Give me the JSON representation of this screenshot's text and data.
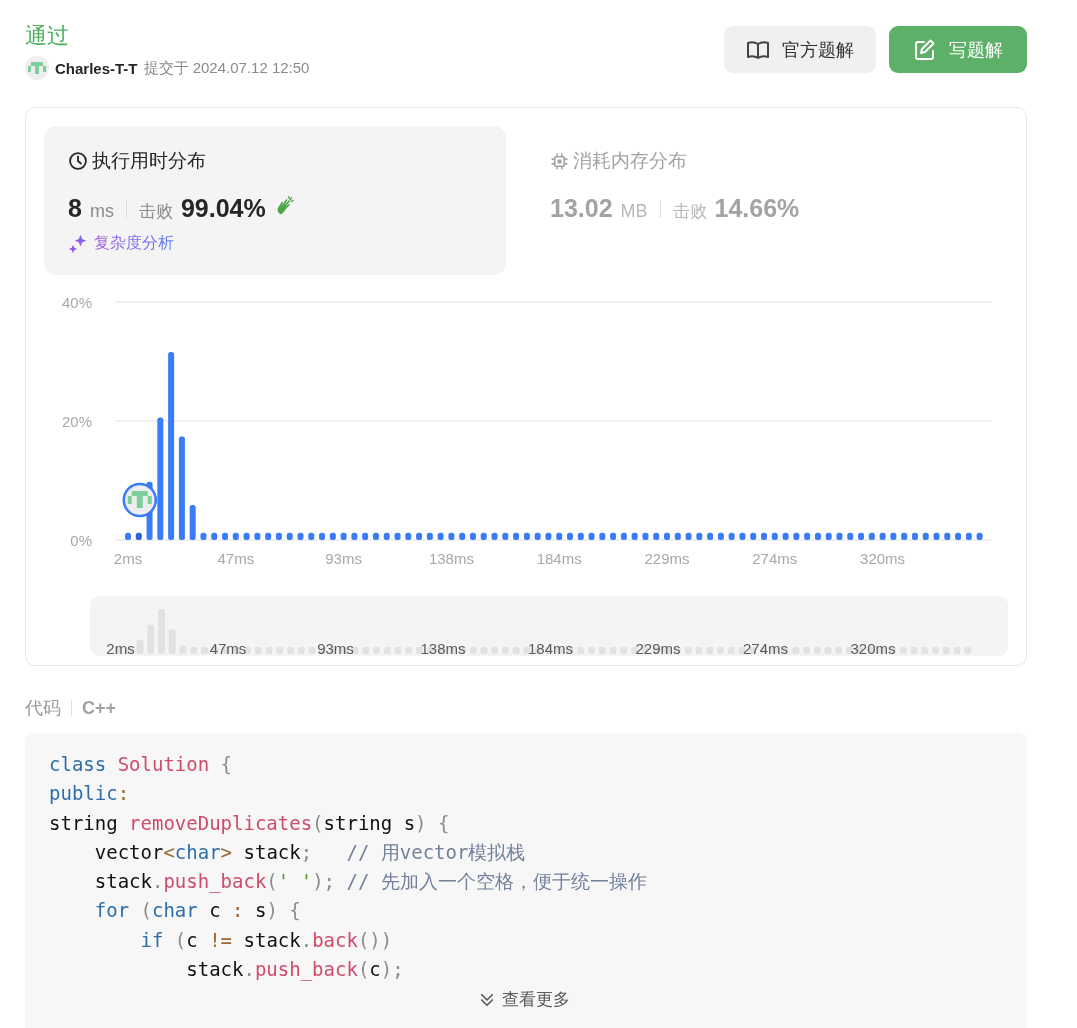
{
  "status": "通过",
  "submission": {
    "user": "Charles-T-T",
    "submitted_label": "提交于",
    "time": "2024.07.12 12:50"
  },
  "buttons": [
    {
      "label": "官方题解",
      "kind": "solutions"
    },
    {
      "label": "写题解",
      "kind": "write"
    }
  ],
  "stats": [
    {
      "kind": "runtime",
      "title": "执行用时分布",
      "value": "8",
      "unit": "ms",
      "beat_label": "击败",
      "beat": "99.04%",
      "selected": true,
      "link": "复杂度分析"
    },
    {
      "kind": "memory",
      "title": "消耗内存分布",
      "value": "13.02",
      "unit": "MB",
      "beat_label": "击败",
      "beat": "14.66%",
      "selected": false
    }
  ],
  "chart_data": {
    "type": "bar",
    "ylim": [
      0,
      40
    ],
    "yticks": [
      {
        "value": 0,
        "label": "0%"
      },
      {
        "value": 20,
        "label": "20%"
      },
      {
        "value": 40,
        "label": "40%"
      }
    ],
    "categories": [
      "2ms",
      null,
      null,
      null,
      null,
      null,
      null,
      null,
      null,
      null,
      "47ms",
      null,
      null,
      null,
      null,
      null,
      null,
      null,
      null,
      null,
      "93ms",
      null,
      null,
      null,
      null,
      null,
      null,
      null,
      null,
      null,
      "138ms",
      null,
      null,
      null,
      null,
      null,
      null,
      null,
      null,
      null,
      "184ms",
      null,
      null,
      null,
      null,
      null,
      null,
      null,
      null,
      null,
      "229ms",
      null,
      null,
      null,
      null,
      null,
      null,
      null,
      null,
      null,
      "274ms",
      null,
      null,
      null,
      null,
      null,
      null,
      null,
      null,
      null,
      "320ms",
      null,
      null,
      null,
      null,
      null,
      null,
      null,
      null,
      null
    ],
    "values": [
      1.2,
      1.2,
      9.8,
      20.6,
      31.6,
      17.4,
      5.9,
      1.2,
      1.2,
      1.2,
      1.2,
      1.2,
      1.2,
      1.2,
      1.2,
      1.2,
      1.2,
      1.2,
      1.2,
      1.2,
      1.2,
      1.2,
      1.2,
      1.2,
      1.2,
      1.2,
      1.2,
      1.2,
      1.2,
      1.2,
      1.2,
      1.2,
      1.2,
      1.2,
      1.2,
      1.2,
      1.2,
      1.2,
      1.2,
      1.2,
      1.2,
      1.2,
      1.2,
      1.2,
      1.2,
      1.2,
      1.2,
      1.2,
      1.2,
      1.2,
      1.2,
      1.2,
      1.2,
      1.2,
      1.2,
      1.2,
      1.2,
      1.2,
      1.2,
      1.2,
      1.2,
      1.2,
      1.2,
      1.2,
      1.2,
      1.2,
      1.2,
      1.2,
      1.2,
      1.2,
      1.2,
      1.2,
      1.2,
      1.2,
      1.2,
      1.2,
      1.2,
      1.2,
      1.2,
      1.2
    ]
  },
  "overview": {
    "tick_labels": [
      "2ms",
      "47ms",
      "93ms",
      "138ms",
      "184ms",
      "229ms",
      "274ms",
      "320ms"
    ]
  },
  "code": {
    "label": "代码",
    "language": "C++",
    "more": "查看更多",
    "lines": [
      [
        {
          "t": "class ",
          "kind": "keyword"
        },
        {
          "t": "Solution",
          "kind": "name"
        },
        {
          "t": " {",
          "kind": "punct"
        }
      ],
      [
        {
          "t": "public",
          "kind": "keyword"
        },
        {
          "t": ":",
          "kind": "op"
        }
      ],
      [
        {
          "t": "string ",
          "kind": "plain"
        },
        {
          "t": "removeDuplicates",
          "kind": "name"
        },
        {
          "t": "(",
          "kind": "punct"
        },
        {
          "t": "string s",
          "kind": "plain"
        },
        {
          "t": ") {",
          "kind": "punct"
        }
      ],
      [
        {
          "t": "    vector",
          "kind": "plain"
        },
        {
          "t": "<",
          "kind": "op"
        },
        {
          "t": "char",
          "kind": "keyword"
        },
        {
          "t": ">",
          "kind": "op"
        },
        {
          "t": " stack",
          "kind": "plain"
        },
        {
          "t": ";",
          "kind": "punct"
        },
        {
          "t": "   // 用vector模拟栈",
          "kind": "comment"
        }
      ],
      [
        {
          "t": "    stack",
          "kind": "plain"
        },
        {
          "t": ".",
          "kind": "punct"
        },
        {
          "t": "push_back",
          "kind": "name"
        },
        {
          "t": "(",
          "kind": "punct"
        },
        {
          "t": "' '",
          "kind": "string"
        },
        {
          "t": ");",
          "kind": "punct"
        },
        {
          "t": " // 先加入一个空格，便于统一操作",
          "kind": "comment"
        }
      ],
      [
        {
          "t": "    for",
          "kind": "keyword"
        },
        {
          "t": " (",
          "kind": "punct"
        },
        {
          "t": "char",
          "kind": "keyword"
        },
        {
          "t": " c ",
          "kind": "plain"
        },
        {
          "t": ":",
          "kind": "op"
        },
        {
          "t": " s",
          "kind": "plain"
        },
        {
          "t": ") {",
          "kind": "punct"
        }
      ],
      [
        {
          "t": "        if",
          "kind": "keyword"
        },
        {
          "t": " (",
          "kind": "punct"
        },
        {
          "t": "c ",
          "kind": "plain"
        },
        {
          "t": "!=",
          "kind": "op"
        },
        {
          "t": " stack",
          "kind": "plain"
        },
        {
          "t": ".",
          "kind": "punct"
        },
        {
          "t": "back",
          "kind": "name"
        },
        {
          "t": "())",
          "kind": "punct"
        }
      ],
      [
        {
          "t": "            stack",
          "kind": "plain"
        },
        {
          "t": ".",
          "kind": "punct"
        },
        {
          "t": "push_back",
          "kind": "name"
        },
        {
          "t": "(",
          "kind": "punct"
        },
        {
          "t": "c",
          "kind": "plain"
        },
        {
          "t": ");",
          "kind": "punct"
        }
      ]
    ]
  }
}
